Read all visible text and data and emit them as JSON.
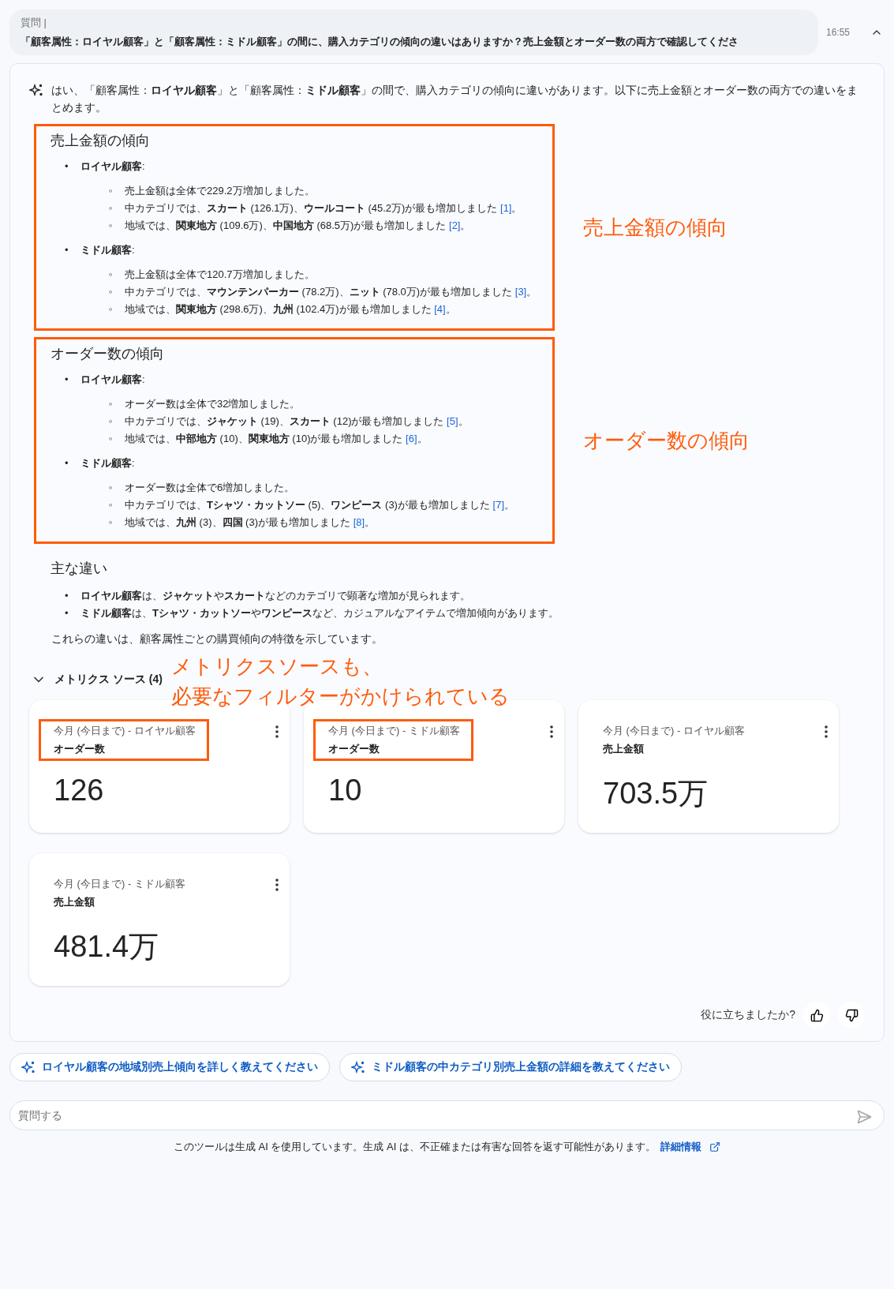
{
  "question": {
    "label": "質問 |",
    "text": "「顧客属性：ロイヤル顧客」と「顧客属性：ミドル顧客」の間に、購入カテゴリの傾向の違いはありますか？売上金額とオーダー数の両方で確認してくださ",
    "time": "16:55",
    "expanded": true
  },
  "answer": {
    "intro": "はい、「顧客属性：**ロイヤル顧客**」と「顧客属性：**ミドル顧客**」の間で、購入カテゴリの傾向に違いがあります。以下に売上金額とオーダー数の両方での違いをまとめます。",
    "sections": [
      {
        "title": "売上金額の傾向",
        "highlighted": true,
        "annotation": "売上金額の傾向",
        "groups": [
          {
            "bullet": "•",
            "label": "**ロイヤル顧客**:",
            "items": [
              {
                "bullet": "◦",
                "text": "売上金額は全体で229.2万増加しました。"
              },
              {
                "bullet": "◦",
                "text": "中カテゴリでは、**スカート** (126.1万)、**ウールコート** (45.2万)が最も増加しました",
                "ref": "[1]",
                "end": "。"
              },
              {
                "bullet": "◦",
                "text": "地域では、**関東地方** (109.6万)、**中国地方** (68.5万)が最も増加しました",
                "ref": "[2]",
                "end": "。"
              }
            ]
          },
          {
            "bullet": "•",
            "label": "**ミドル顧客**:",
            "items": [
              {
                "bullet": "◦",
                "text": "売上金額は全体で120.7万増加しました。"
              },
              {
                "bullet": "◦",
                "text": "中カテゴリでは、**マウンテンパーカー** (78.2万)、**ニット** (78.0万)が最も増加しました",
                "ref": "[3]",
                "end": "。"
              },
              {
                "bullet": "◦",
                "text": "地域では、**関東地方** (298.6万)、**九州** (102.4万)が最も増加しました",
                "ref": "[4]",
                "end": "。"
              }
            ]
          }
        ]
      },
      {
        "title": "オーダー数の傾向",
        "highlighted": true,
        "annotation": "オーダー数の傾向",
        "groups": [
          {
            "bullet": "•",
            "label": "**ロイヤル顧客**:",
            "items": [
              {
                "bullet": "◦",
                "text": "オーダー数は全体で32増加しました。"
              },
              {
                "bullet": "◦",
                "text": "中カテゴリでは、**ジャケット** (19)、**スカート** (12)が最も増加しました",
                "ref": "[5]",
                "end": "。"
              },
              {
                "bullet": "◦",
                "text": "地域では、**中部地方** (10)、**関東地方** (10)が最も増加しました",
                "ref": "[6]",
                "end": "。"
              }
            ]
          },
          {
            "bullet": "•",
            "label": "**ミドル顧客**:",
            "items": [
              {
                "bullet": "◦",
                "text": "オーダー数は全体で6増加しました。"
              },
              {
                "bullet": "◦",
                "text": "中カテゴリでは、**Tシャツ・カットソー** (5)、**ワンピース** (3)が最も増加しました",
                "ref": "[7]",
                "end": "。"
              },
              {
                "bullet": "◦",
                "text": "地域では、**九州** (3)、**四国** (3)が最も増加しました",
                "ref": "[8]",
                "end": "。"
              }
            ]
          }
        ]
      }
    ],
    "summary": {
      "title": "主な違い",
      "bullets": [
        {
          "bullet": "•",
          "text": "**ロイヤル顧客**は、**ジャケット**や**スカート**などのカテゴリで顕著な増加が見られます。"
        },
        {
          "bullet": "•",
          "text": "**ミドル顧客**は、**Tシャツ・カットソー**や**ワンピース**など、カジュアルなアイテムで増加傾向があります。"
        }
      ]
    },
    "conclusion": "これらの違いは、顧客属性ごとの購買傾向の特徴を示しています。"
  },
  "metrics": {
    "title": "メトリクス ソース (4)",
    "expanded": true,
    "annotation": [
      "メトリクスソースも、",
      "必要なフィルターがかけられている"
    ],
    "cards": [
      {
        "period": "今月 (今日まで) - ロイヤル顧客",
        "metric": "オーダー数",
        "value": "126",
        "highlighted": true
      },
      {
        "period": "今月 (今日まで) - ミドル顧客",
        "metric": "オーダー数",
        "value": "10",
        "highlighted": true
      },
      {
        "period": "今月 (今日まで) - ロイヤル顧客",
        "metric": "売上金額",
        "value": "703.5万",
        "highlighted": false
      },
      {
        "period": "今月 (今日まで) - ミドル顧客",
        "metric": "売上金額",
        "value": "481.4万",
        "highlighted": false
      }
    ]
  },
  "feedback": {
    "label": "役に立ちましたか?"
  },
  "suggestions": [
    "ロイヤル顧客の地域別売上傾向を詳しく教えてください",
    "ミドル顧客の中カテゴリ別売上金額の詳細を教えてください"
  ],
  "input": {
    "placeholder": "質問する"
  },
  "footer": {
    "text": "このツールは生成 AI を使用しています。生成 AI は、不正確または有害な回答を返す可能性があります。",
    "link": "詳細情報"
  }
}
